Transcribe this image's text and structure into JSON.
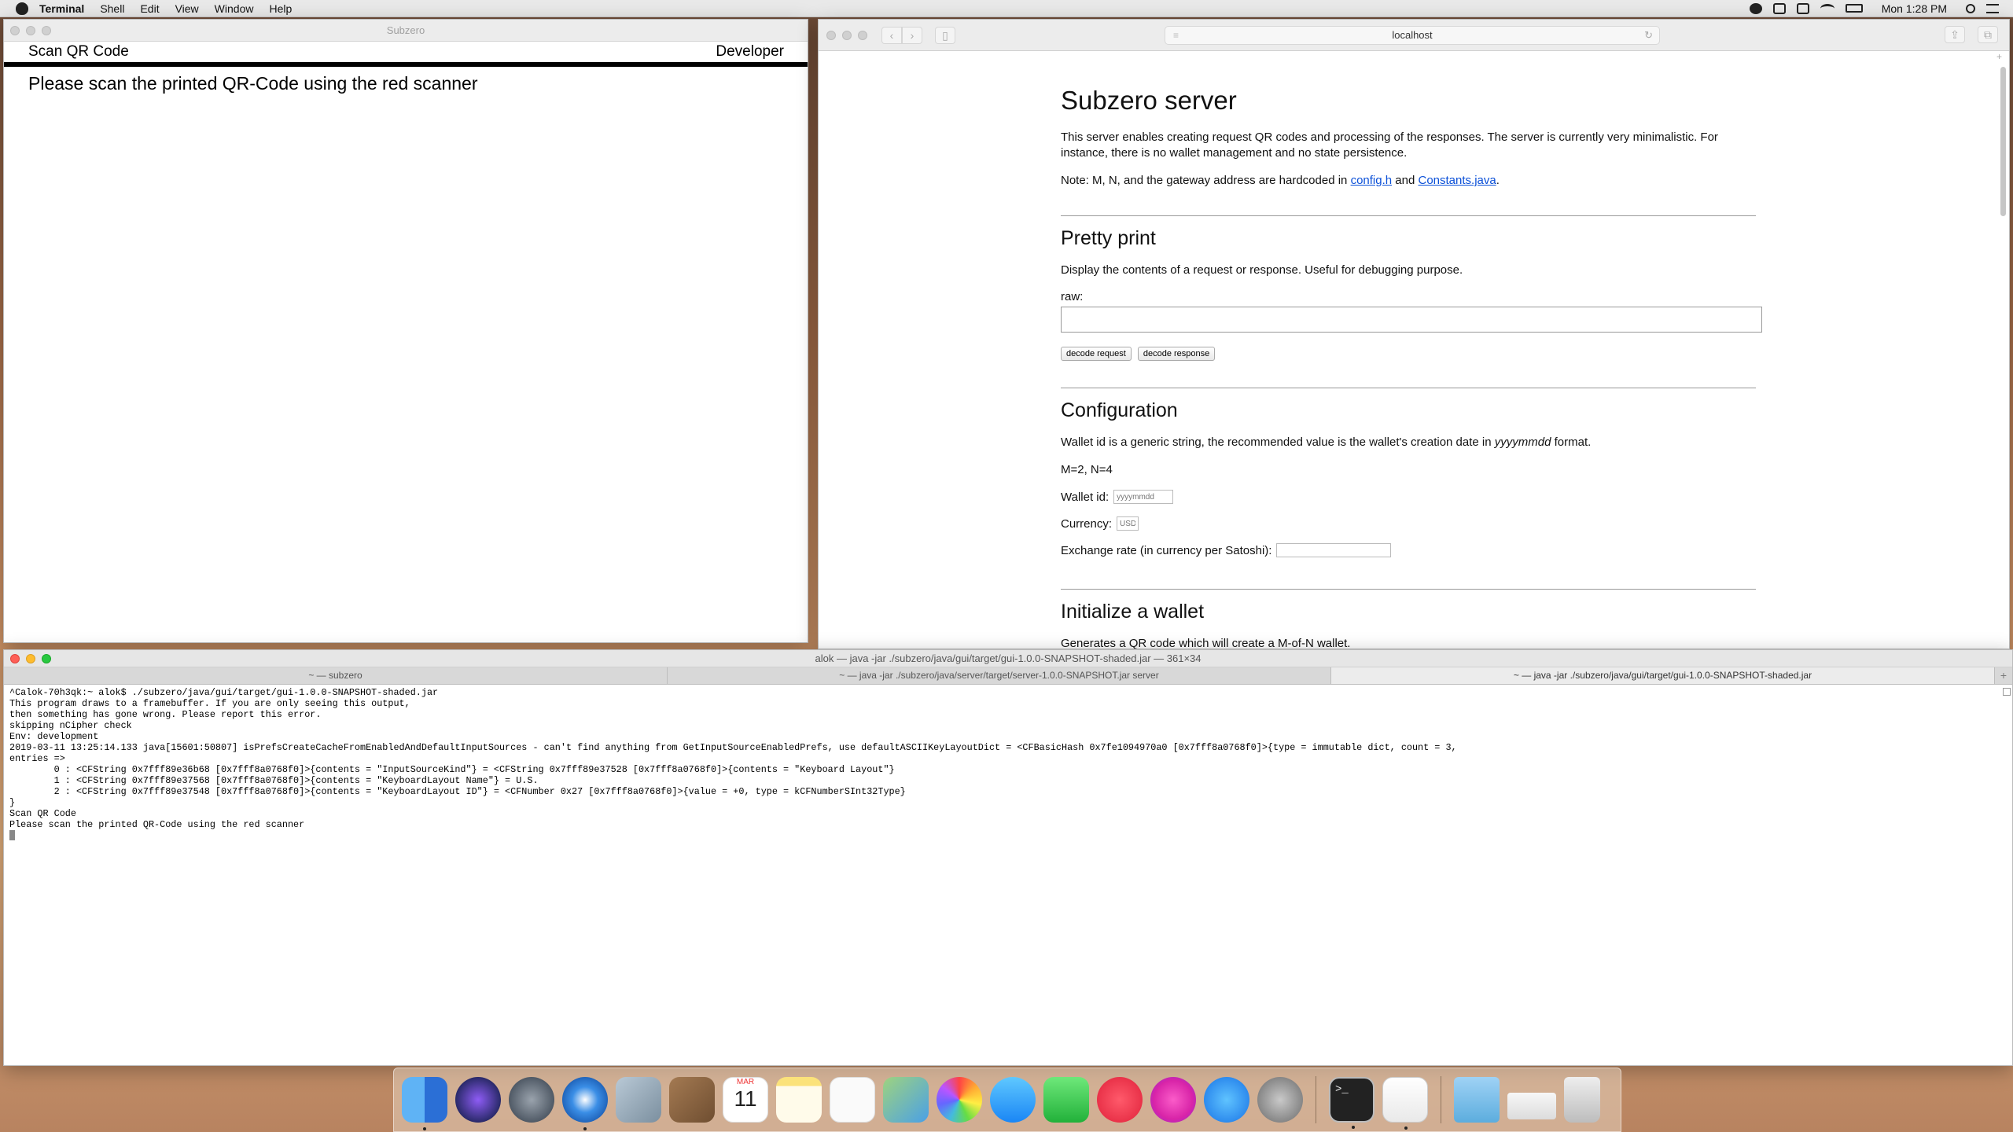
{
  "menubar": {
    "app": "Terminal",
    "items": [
      "Shell",
      "Edit",
      "View",
      "Window",
      "Help"
    ],
    "clock": "Mon 1:28 PM"
  },
  "subzero": {
    "window_title": "Subzero",
    "header_left": "Scan QR Code",
    "header_right": "Developer",
    "message": "Please scan the printed QR-Code using the red scanner"
  },
  "browser": {
    "address": "localhost",
    "page": {
      "title": "Subzero server",
      "intro": "This server enables creating request QR codes and processing of the responses. The server is currently very minimalistic. For instance, there is no wallet management and no state persistence.",
      "note_prefix": "Note: M, N, and the gateway address are hardcoded in ",
      "note_link1": "config.h",
      "note_and": " and ",
      "note_link2": "Constants.java",
      "note_suffix": ".",
      "pretty_print": {
        "heading": "Pretty print",
        "description": "Display the contents of a request or response. Useful for debugging purpose.",
        "raw_label": "raw:",
        "decode_request": "decode request",
        "decode_response": "decode response"
      },
      "configuration": {
        "heading": "Configuration",
        "desc_prefix": "Wallet id is a generic string, the recommended value is the wallet's creation date in ",
        "desc_em": "yyyymmdd",
        "desc_suffix": " format.",
        "mn": "M=2, N=4",
        "wallet_id_label": "Wallet id:",
        "wallet_id_placeholder": "yyyymmdd",
        "currency_label": "Currency:",
        "currency_placeholder": "USD",
        "exchange_label": "Exchange rate (in currency per Satoshi):",
        "exchange_value": ""
      },
      "initialize": {
        "heading": "Initialize a wallet",
        "partial_text": "Generates a QR code which will create a M-of-N wallet."
      }
    }
  },
  "terminal": {
    "window_title": "alok — java -jar ./subzero/java/gui/target/gui-1.0.0-SNAPSHOT-shaded.jar — 361×34",
    "tabs": [
      "~ — subzero",
      "~ — java -jar ./subzero/java/server/target/server-1.0.0-SNAPSHOT.jar server",
      "~ — java -jar ./subzero/java/gui/target/gui-1.0.0-SNAPSHOT-shaded.jar"
    ],
    "lines": [
      "^Calok-70h3qk:~ alok$ ./subzero/java/gui/target/gui-1.0.0-SNAPSHOT-shaded.jar",
      "This program draws to a framebuffer. If you are only seeing this output,",
      "then something has gone wrong. Please report this error.",
      "skipping nCipher check",
      "Env: development",
      "2019-03-11 13:25:14.133 java[15601:50807] isPrefsCreateCacheFromEnabledAndDefaultInputSources - can't find anything from GetInputSourceEnabledPrefs, use defaultASCIIKeyLayoutDict = <CFBasicHash 0x7fe1094970a0 [0x7fff8a0768f0]>{type = immutable dict, count = 3,",
      "entries =>",
      "        0 : <CFString 0x7fff89e36b68 [0x7fff8a0768f0]>{contents = \"InputSourceKind\"} = <CFString 0x7fff89e37528 [0x7fff8a0768f0]>{contents = \"Keyboard Layout\"}",
      "        1 : <CFString 0x7fff89e37568 [0x7fff8a0768f0]>{contents = \"KeyboardLayout Name\"} = U.S.",
      "        2 : <CFString 0x7fff89e37548 [0x7fff8a0768f0]>{contents = \"KeyboardLayout ID\"} = <CFNumber 0x27 [0x7fff8a0768f0]>{value = +0, type = kCFNumberSInt32Type}",
      "}",
      "Scan QR Code",
      "Please scan the printed QR-Code using the red scanner"
    ]
  },
  "dock": {
    "date_month": "MAR",
    "date_day": "11"
  },
  "colors": {
    "link": "#0b50d8",
    "close": "#fe5f57",
    "minimize": "#febc2e",
    "zoom": "#28c840"
  }
}
